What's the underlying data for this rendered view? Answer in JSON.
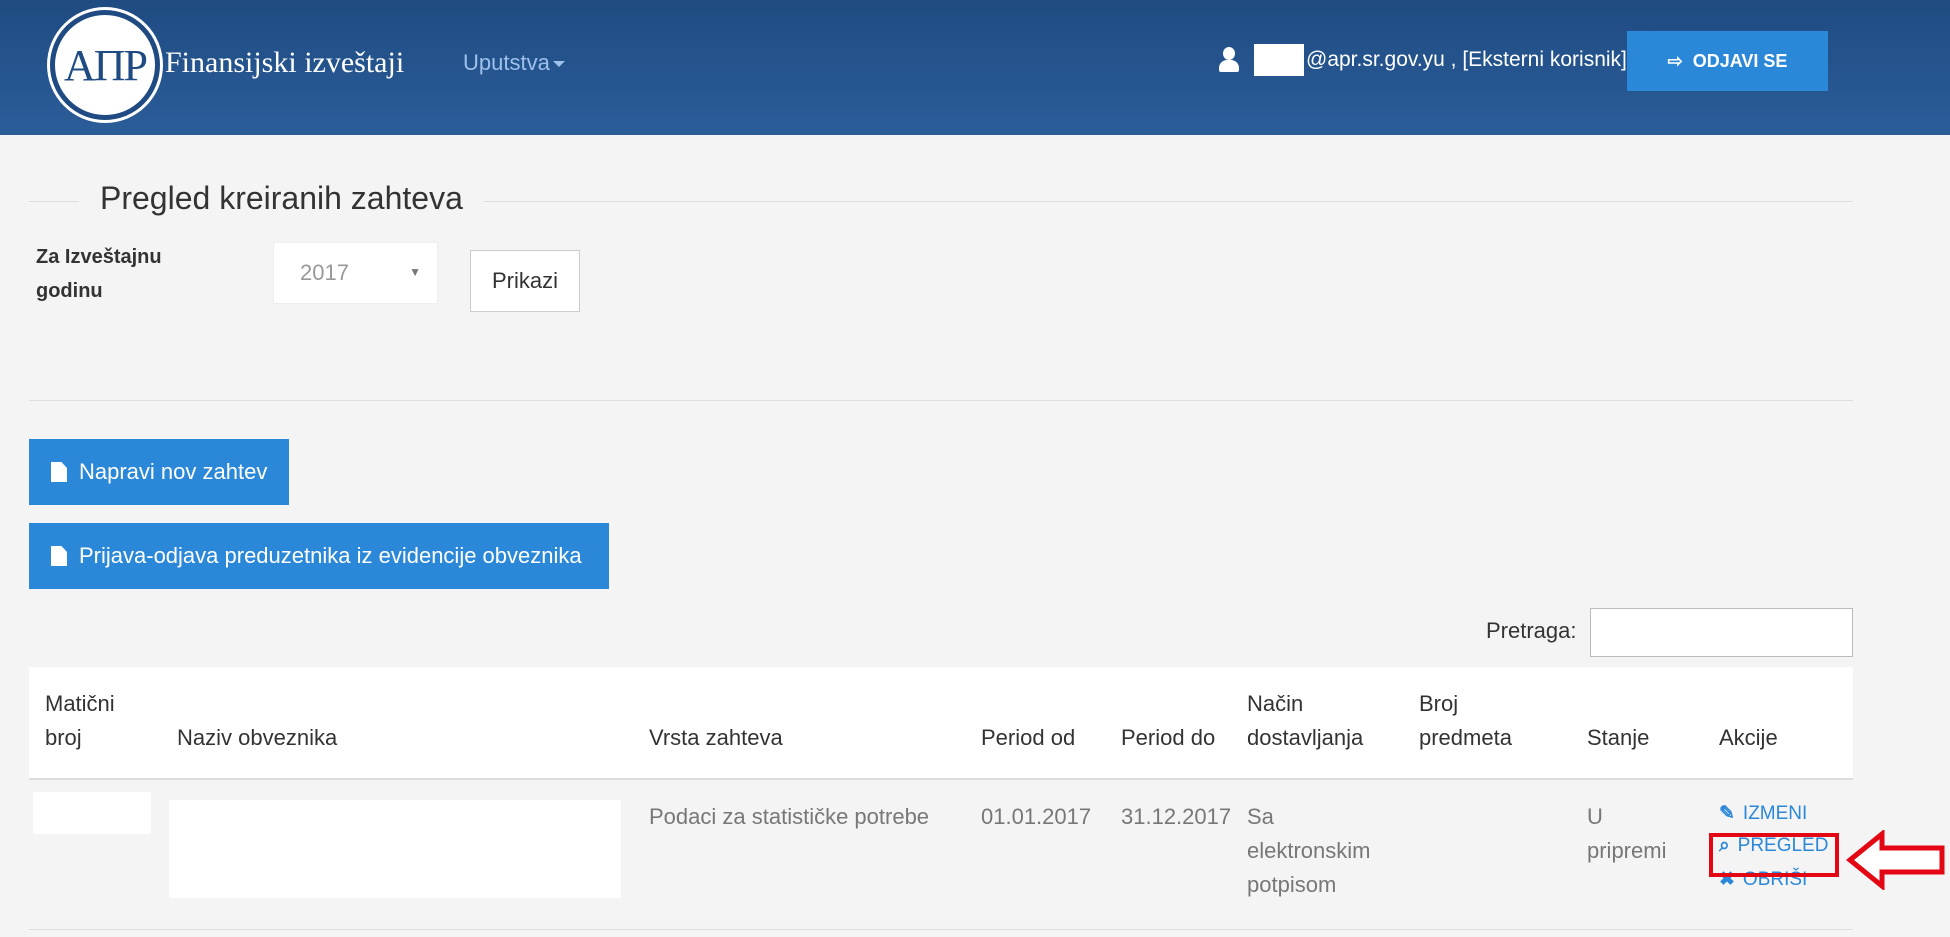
{
  "header": {
    "logo_text": "АПР",
    "brand": "Finansijski izveštaji",
    "menu_instructions": "Uputstva",
    "user_text": "@apr.sr.gov.yu , [Eksterni korisnik]",
    "logout_label": "ODJAVI SE"
  },
  "filter": {
    "legend": "Pregled kreiranih zahteva",
    "year_label": "Za Izveštajnu godinu",
    "year_value": "2017",
    "show_label": "Prikazi"
  },
  "actions": {
    "new_request": "Napravi nov zahtev",
    "register_entrepreneur": "Prijava-odjava preduzetnika iz evidencije obveznika"
  },
  "search": {
    "label": "Pretraga:",
    "value": ""
  },
  "table": {
    "columns": [
      "Matični broj",
      "Naziv obveznika",
      "Vrsta zahteva",
      "Period od",
      "Period do",
      "Način dostavljanja",
      "Broj predmeta",
      "Stanje",
      "Akcije"
    ],
    "rows": [
      {
        "registration_no": "",
        "name": "",
        "request_type": "Podaci za statističke potrebe",
        "period_from": "01.01.2017",
        "period_to": "31.12.2017",
        "delivery": "Sa elektronskim potpisom",
        "case_no": "",
        "status": "U pripremi",
        "actions": [
          "IZMENI",
          "PREGLED",
          "OBRIŠI"
        ]
      }
    ]
  },
  "colors": {
    "navbar": "#1f4b82",
    "primary": "#2b88d8",
    "highlight": "#e30613"
  },
  "icons": [
    "user-icon",
    "logout-icon",
    "document-icon",
    "edit-icon",
    "search-icon",
    "delete-icon",
    "arrow-left-icon"
  ]
}
